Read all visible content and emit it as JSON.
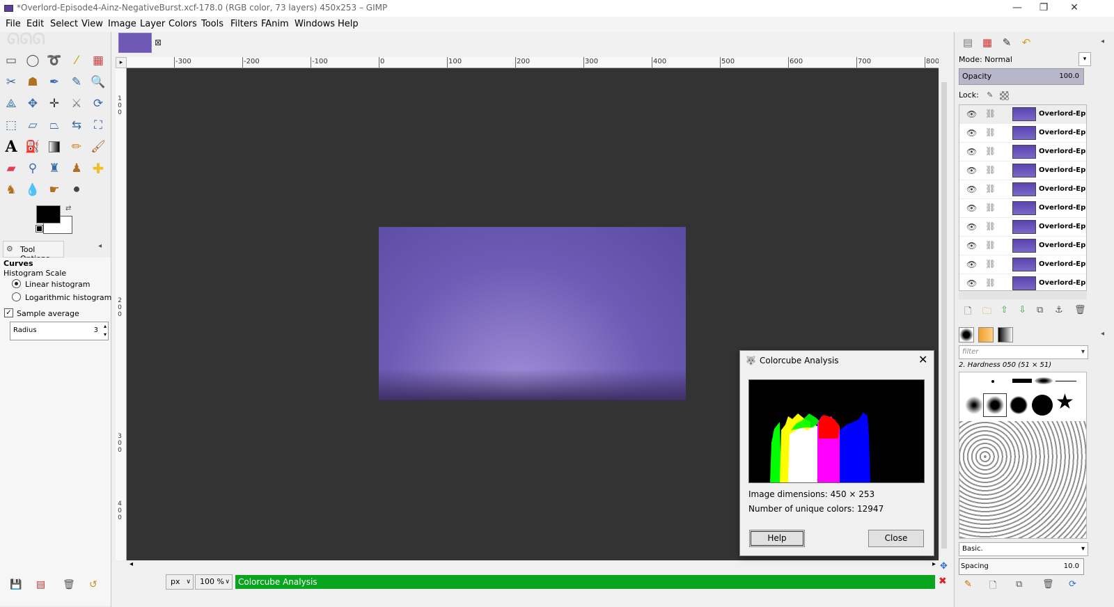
{
  "window": {
    "title": "*Overlord-Episode4-Ainz-NegativeBurst.xcf-178.0 (RGB color, 73 layers) 450x253 – GIMP",
    "minimize": "—",
    "maximize": "❐",
    "close": "✕"
  },
  "menubar": [
    "File",
    "Edit",
    "Select",
    "View",
    "Image",
    "Layer",
    "Colors",
    "Tools",
    "Filters",
    "FAnim",
    "Windows",
    "Help"
  ],
  "toolbox": {
    "tool_options_tab": "Tool Options",
    "active_tool": "Curves",
    "histogram_scale_label": "Histogram Scale",
    "linear_label": "Linear histogram",
    "log_label": "Logarithmic histogram",
    "sample_average_label": "Sample average",
    "radius_label": "Radius",
    "radius_value": "3",
    "checkmark": "✓"
  },
  "canvas": {
    "ruler_labels": [
      "-300",
      "-200",
      "-100",
      "0",
      "100",
      "200",
      "300",
      "400",
      "500",
      "600",
      "700",
      "800"
    ],
    "vruler_labels": [
      "1",
      "0",
      "0",
      "2",
      "0",
      "0",
      "3",
      "0",
      "0",
      "4",
      "0",
      "0"
    ]
  },
  "statusbar": {
    "unit": "px",
    "zoom": "100 %",
    "message": "Colorcube Analysis"
  },
  "layers_panel": {
    "mode_label": "Mode: Normal",
    "opacity_label": "Opacity",
    "opacity_value": "100.0",
    "lock_label": "Lock:",
    "layer_names": [
      "Overlord-Ep",
      "Overlord-Ep",
      "Overlord-Ep",
      "Overlord-Ep",
      "Overlord-Ep",
      "Overlord-Ep",
      "Overlord-Ep",
      "Overlord-Ep",
      "Overlord-Ep",
      "Overlord-Ep"
    ]
  },
  "brushes_panel": {
    "filter_placeholder": "filter",
    "brush_name": "2. Hardness 050 (51 × 51)",
    "preset": "Basic.",
    "spacing_label": "Spacing",
    "spacing_value": "10.0"
  },
  "dialog": {
    "title": "Colorcube Analysis",
    "dimensions": "Image dimensions: 450 × 253",
    "unique_colors": "Number of unique colors: 12947",
    "help_button": "Help",
    "close_button": "Close"
  },
  "colors": {
    "status_green": "#0aa51e",
    "canvas_bg": "#333333",
    "image_purple": "#6d5cb5"
  }
}
